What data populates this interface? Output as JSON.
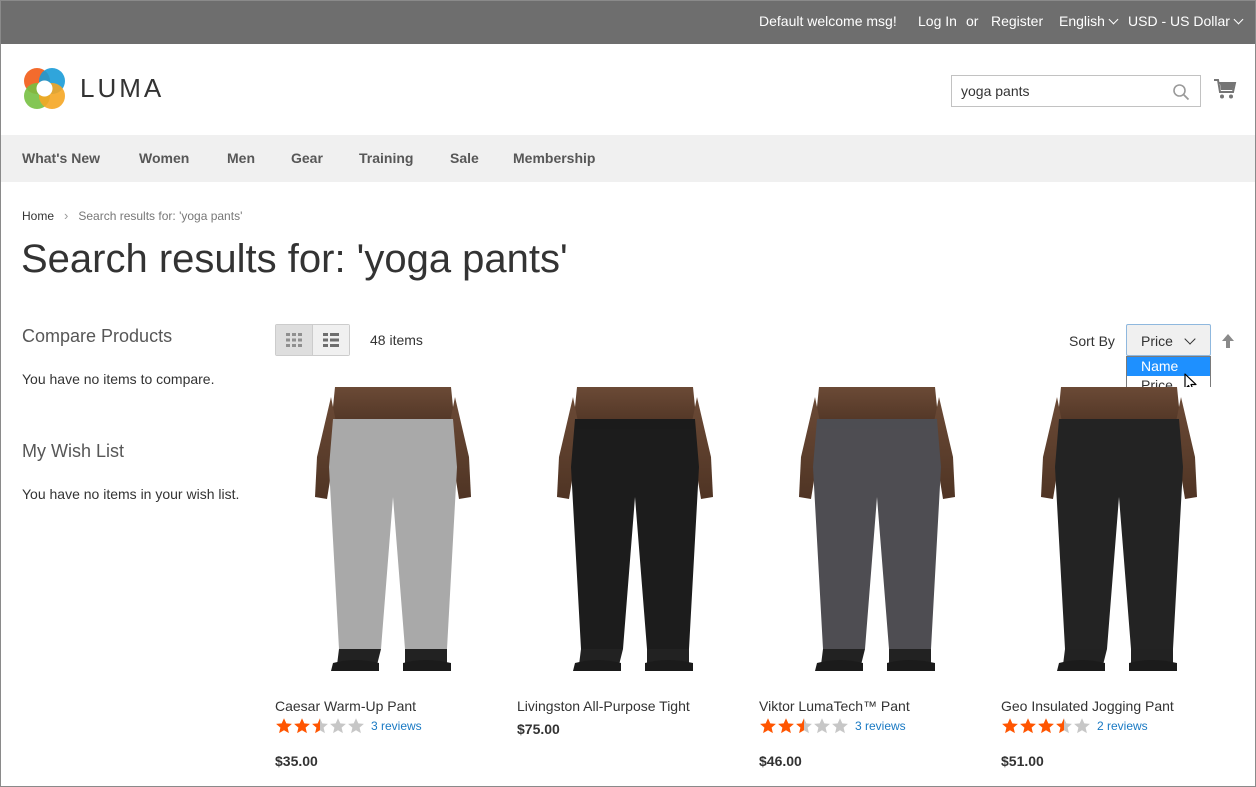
{
  "topbar": {
    "welcome": "Default welcome msg!",
    "login": "Log In",
    "or": "or",
    "register": "Register",
    "language": "English",
    "currency": "USD - US Dollar"
  },
  "header": {
    "logo_text": "LUMA",
    "search_value": "yoga pants",
    "cart_icon": "shopping-cart-icon"
  },
  "nav": {
    "items": [
      "What's New",
      "Women",
      "Men",
      "Gear",
      "Training",
      "Sale",
      "Membership"
    ]
  },
  "breadcrumb": {
    "home": "Home",
    "separator": "›",
    "current": "Search results for: 'yoga pants'"
  },
  "page_title": "Search results for: 'yoga pants'",
  "sidebar": {
    "compare_title": "Compare Products",
    "compare_text": "You have no items to compare.",
    "wishlist_title": "My Wish List",
    "wishlist_text": "You have no items in your wish list."
  },
  "toolbar": {
    "item_count": "48 items",
    "sort_label": "Sort By",
    "sort_selected": "Price",
    "sort_options": [
      "Name",
      "Price"
    ],
    "highlighted_option": "Name"
  },
  "products": [
    {
      "name": "Caesar Warm-Up Pant",
      "rating_stars": 2.5,
      "reviews": "3 reviews",
      "price": "$35.00",
      "pant_color": "#a9a9a9"
    },
    {
      "name": "Livingston All-Purpose Tight",
      "rating_stars": null,
      "reviews": "",
      "price": "$75.00",
      "pant_color": "#1c1c1c"
    },
    {
      "name": "Viktor LumaTech™ Pant",
      "rating_stars": 2.5,
      "reviews": "3 reviews",
      "price": "$46.00",
      "pant_color": "#4e4d52"
    },
    {
      "name": "Geo Insulated Jogging Pant",
      "rating_stars": 3.5,
      "reviews": "2 reviews",
      "price": "$51.00",
      "pant_color": "#232323"
    }
  ],
  "colors": {
    "topbar_bg": "#6e6e6e",
    "nav_bg": "#f0f0f0",
    "link": "#1979c3",
    "star_filled": "#ff5501",
    "star_empty": "#c7c7c7",
    "dropdown_highlight": "#1e90ff"
  }
}
